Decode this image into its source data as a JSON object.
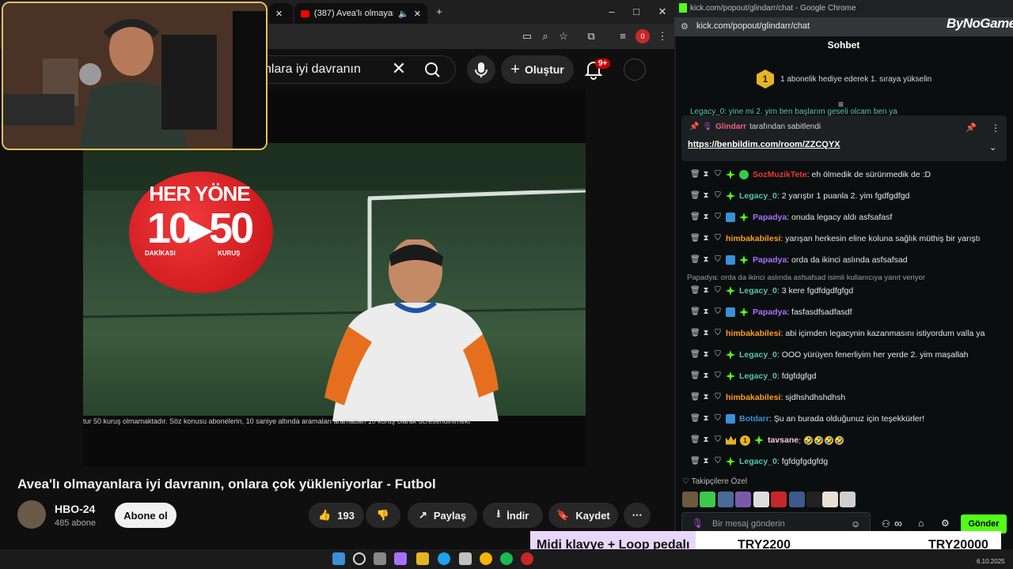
{
  "yt_window": {
    "tab_title": "(387) Avea'lı olmayanlara iyi d",
    "search_value": "nlara iyi davranın",
    "create_label": "Oluştur",
    "notification_count": "9+",
    "video_title": "Avea'lı olmayanlara iyi davranın, onlara çok yükleniyorlar - Futbol",
    "ad_text_1": "HER YÖNE",
    "ad_text_2": "10▸50",
    "ad_text_3": "DAKİKASI",
    "ad_text_4": "KURUŞ",
    "video_caption": "tur 50 kuruş olmamaktadır. Söz konusu abonelerin, 10 saniye altında aramaları aramadan 10 kuruş olarak ücretlendirilmekt",
    "channel_name": "HBO-24",
    "channel_subs": "485 abone",
    "subscribe_label": "Abone ol",
    "like_count": "193",
    "share_label": "Paylaş",
    "download_label": "İndir",
    "save_label": "Kaydet"
  },
  "chat_window": {
    "window_title": "kick.com/popout/glindarr/chat - Google Chrome",
    "url": "kick.com/popout/glindarr/chat",
    "header": "Sohbet",
    "goal_number": "1",
    "goal_text": "1 abonelik hediye ederek 1. sıraya yükselin",
    "partial_msg": "Legacy_0: yine mi 2. yim ben başlarım geseli olcam ben ya",
    "pinned_by_user": "Glindarr",
    "pinned_by_text": "tarafından sabitlendi",
    "pinned_link": "https://benbildim.com/room/ZZCQYX",
    "reply_note": "Papadya: orda da ikinci aslında asfsafsad isimli kullanıcıya yanıt veriyor",
    "follower_label": "Takipçilere Özel",
    "input_placeholder": "Bir mesaj gönderin",
    "send_label": "Gönder",
    "messages": [
      {
        "user": "SozMuzikTete",
        "text": ": eh ölmedik de sürünmedik de :D",
        "color": "#e53935"
      },
      {
        "user": "Legacy_0",
        "text": ": 2 yarıştır 1 puanla 2. yim fgdfgdfgd",
        "color": "#53c7a8"
      },
      {
        "user": "Papadya",
        "text": ": onuda legacy aldı asfsafasf",
        "color": "#a970ff"
      },
      {
        "user": "himbakabilesi",
        "text": ": yarışan herkesin eline koluna sağlık müthiş bir yarıştı",
        "color": "#ff9f1c"
      },
      {
        "user": "Papadya",
        "text": ": orda da ikinci aslında asfsafsad",
        "color": "#a970ff"
      },
      {
        "user": "Legacy_0",
        "text": ": 3 kere fgdfdgdfgfgd",
        "color": "#53c7a8"
      },
      {
        "user": "Papadya",
        "text": ": fasfasdfsadfasdf",
        "color": "#a970ff"
      },
      {
        "user": "himbakabilesi",
        "text": ": abi içimden legacynin kazanmasını istiyordum valla ya",
        "color": "#ff9f1c"
      },
      {
        "user": "Legacy_0",
        "text": ": OOO yürüyen fenerliyim her yerde 2. yim maşallah",
        "color": "#53c7a8"
      },
      {
        "user": "Legacy_0",
        "text": ": fdgfdgfgd",
        "color": "#53c7a8"
      },
      {
        "user": "himbakabilesi",
        "text": ": sjdhshdhshdhsh",
        "color": "#ff9f1c"
      },
      {
        "user": "Botdarr",
        "text": ": Şu an burada olduğunuz için teşekkürler!",
        "color": "#3a8fd6"
      },
      {
        "user": "tavsane",
        "text": ": 🤣🤣🤣🤣",
        "color": "#f2c6e0"
      },
      {
        "user": "Legacy_0",
        "text": ": fgfdgfgdgfdg",
        "color": "#53c7a8"
      }
    ]
  },
  "overlay": {
    "logo": "ByNoGame",
    "logo_sup": "com",
    "promo_label": "Midi klavye + Loop pedalı",
    "promo_code_1": "TRY2200",
    "promo_code_2": "TRY20000",
    "taskbar_date": "6.10.2025"
  },
  "colors": {
    "kick_green": "#53fc18",
    "yt_red": "#cc0000",
    "webcam_border": "#e8c15a"
  }
}
